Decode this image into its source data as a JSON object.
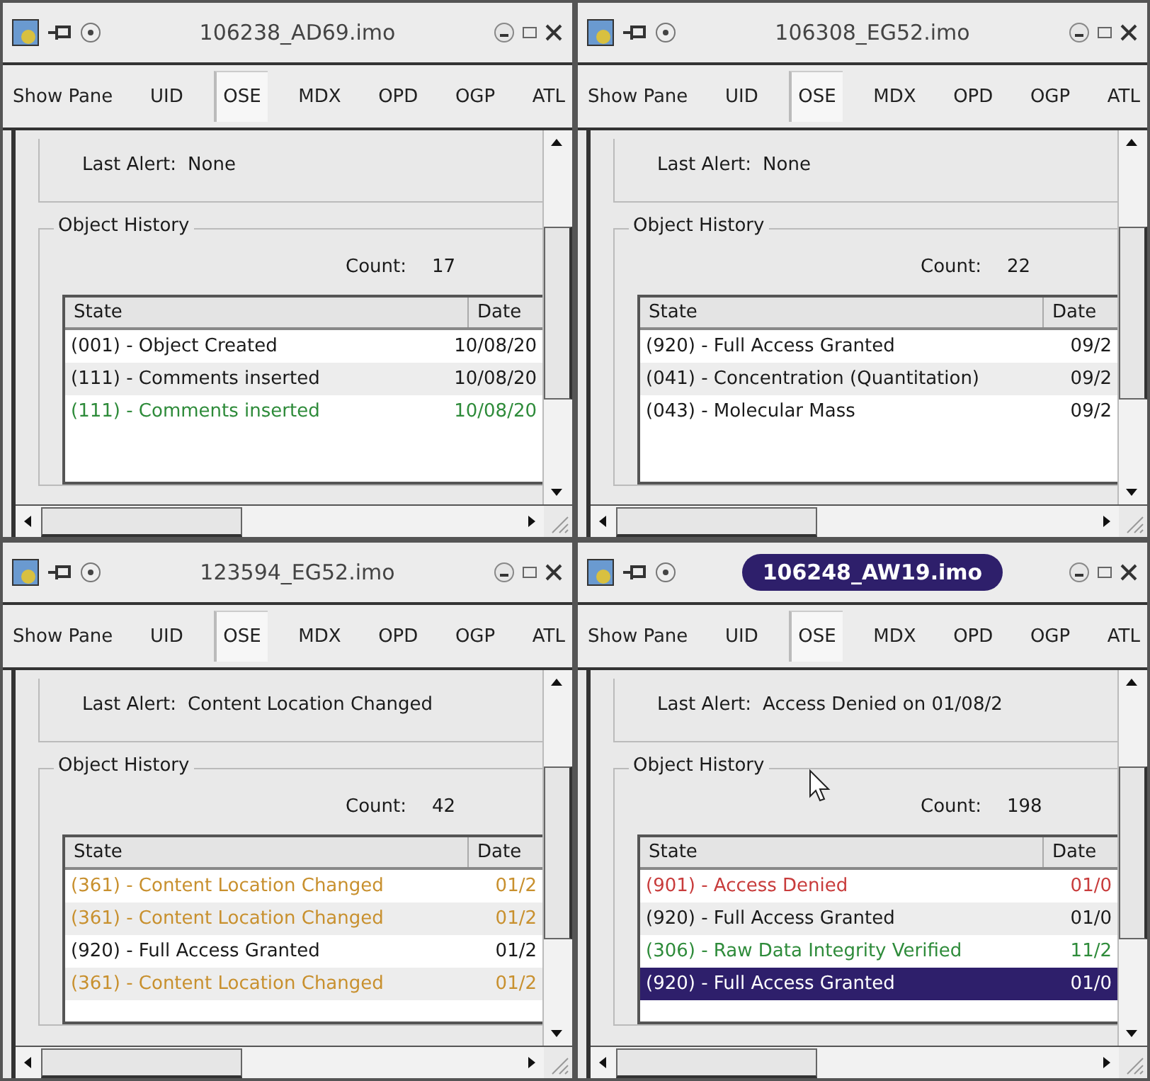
{
  "windows": [
    {
      "title": "106238_AD69.imo",
      "active": false,
      "tabs": [
        {
          "label": "Show Pane",
          "selected": false
        },
        {
          "label": "UID",
          "selected": false
        },
        {
          "label": "OSE",
          "selected": true
        },
        {
          "label": "MDX",
          "selected": false
        },
        {
          "label": "OPD",
          "selected": false
        },
        {
          "label": "OGP",
          "selected": false
        },
        {
          "label": "ATL",
          "selected": false
        }
      ],
      "last_alert_label": "Last Alert:",
      "last_alert": "None",
      "group_title": "Object History",
      "count_label": "Count:",
      "count": "17",
      "columns": [
        "State",
        "Date"
      ],
      "rows": [
        {
          "state": "(001) - Object Created",
          "date": "10/08/20",
          "color": "#1a1a1a",
          "selected": false
        },
        {
          "state": "(111) - Comments inserted",
          "date": "10/08/20",
          "color": "#1a1a1a",
          "selected": false
        },
        {
          "state": "(111) - Comments inserted",
          "date": "10/08/20",
          "color": "#2e8b3a",
          "selected": false
        }
      ]
    },
    {
      "title": "106308_EG52.imo",
      "active": false,
      "tabs": [
        {
          "label": "Show Pane",
          "selected": false
        },
        {
          "label": "UID",
          "selected": false
        },
        {
          "label": "OSE",
          "selected": true
        },
        {
          "label": "MDX",
          "selected": false
        },
        {
          "label": "OPD",
          "selected": false
        },
        {
          "label": "OGP",
          "selected": false
        },
        {
          "label": "ATL",
          "selected": false
        }
      ],
      "last_alert_label": "Last Alert:",
      "last_alert": "None",
      "group_title": "Object History",
      "count_label": "Count:",
      "count": "22",
      "columns": [
        "State",
        "Date"
      ],
      "rows": [
        {
          "state": "(920) - Full Access Granted",
          "date": "09/2",
          "color": "#1a1a1a",
          "selected": false
        },
        {
          "state": "(041) - Concentration (Quantitation)",
          "date": "09/2",
          "color": "#1a1a1a",
          "selected": false
        },
        {
          "state": "(043) - Molecular Mass",
          "date": "09/2",
          "color": "#1a1a1a",
          "selected": false
        }
      ]
    },
    {
      "title": "123594_EG52.imo",
      "active": false,
      "tabs": [
        {
          "label": "Show Pane",
          "selected": false
        },
        {
          "label": "UID",
          "selected": false
        },
        {
          "label": "OSE",
          "selected": true
        },
        {
          "label": "MDX",
          "selected": false
        },
        {
          "label": "OPD",
          "selected": false
        },
        {
          "label": "OGP",
          "selected": false
        },
        {
          "label": "ATL",
          "selected": false
        }
      ],
      "last_alert_label": "Last Alert:",
      "last_alert": "Content Location Changed",
      "group_title": "Object History",
      "count_label": "Count:",
      "count": "42",
      "columns": [
        "State",
        "Date"
      ],
      "rows": [
        {
          "state": "(361) - Content Location Changed",
          "date": "01/2",
          "color": "#c8902e",
          "selected": false
        },
        {
          "state": "(361) - Content Location Changed",
          "date": "01/2",
          "color": "#c8902e",
          "selected": false
        },
        {
          "state": "(920) - Full Access Granted",
          "date": "01/2",
          "color": "#1a1a1a",
          "selected": false
        },
        {
          "state": "(361) - Content Location Changed",
          "date": "01/2",
          "color": "#c8902e",
          "selected": false
        }
      ]
    },
    {
      "title": "106248_AW19.imo",
      "active": true,
      "tabs": [
        {
          "label": "Show Pane",
          "selected": false
        },
        {
          "label": "UID",
          "selected": false
        },
        {
          "label": "OSE",
          "selected": true
        },
        {
          "label": "MDX",
          "selected": false
        },
        {
          "label": "OPD",
          "selected": false
        },
        {
          "label": "OGP",
          "selected": false
        },
        {
          "label": "ATL",
          "selected": false
        }
      ],
      "last_alert_label": "Last Alert:",
      "last_alert": "Access Denied on 01/08/2",
      "group_title": "Object History",
      "count_label": "Count:",
      "count": "198",
      "columns": [
        "State",
        "Date"
      ],
      "rows": [
        {
          "state": "(901) - Access Denied",
          "date": "01/0",
          "color": "#c83c3c",
          "selected": false
        },
        {
          "state": "(920) - Full Access Granted",
          "date": "01/0",
          "color": "#1a1a1a",
          "selected": false
        },
        {
          "state": "(306) - Raw Data Integrity Verified",
          "date": "11/2",
          "color": "#2e8b3a",
          "selected": false
        },
        {
          "state": "(920) - Full Access Granted",
          "date": "01/0",
          "color": "#ffffff",
          "selected": true
        }
      ]
    }
  ]
}
